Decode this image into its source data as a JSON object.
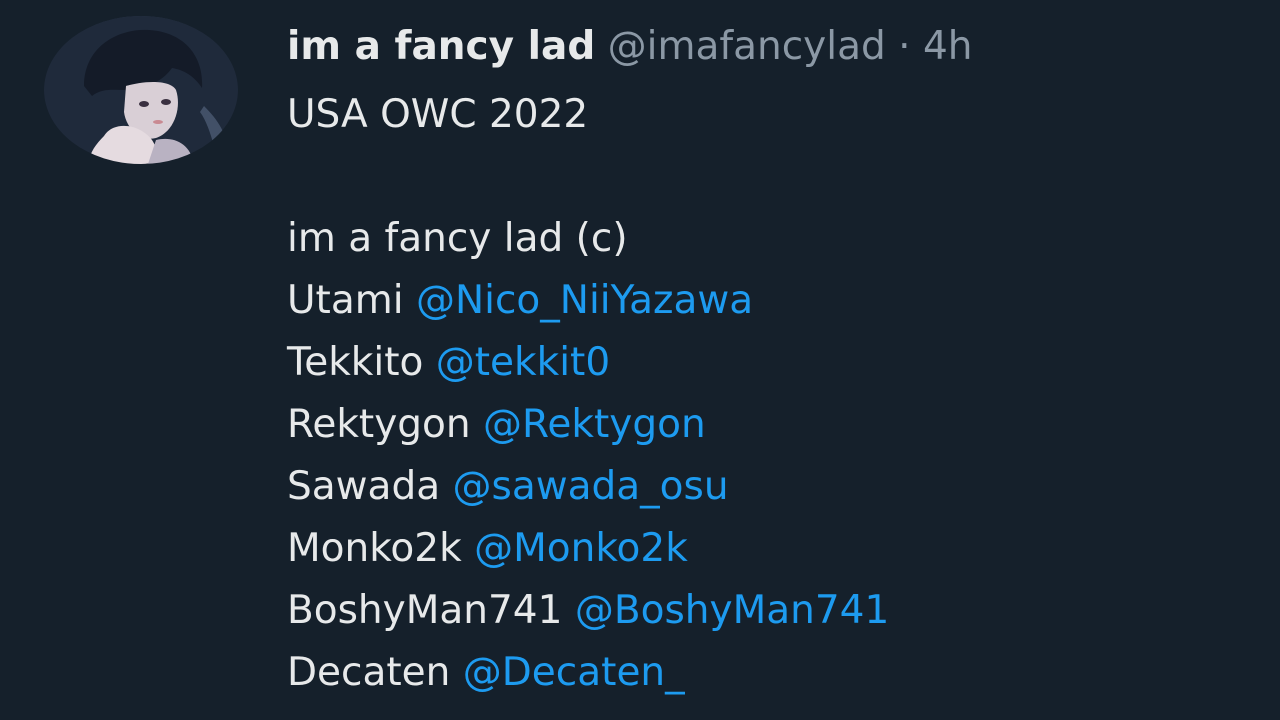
{
  "tweet": {
    "author": {
      "display_name": "im a fancy lad",
      "handle": "@imafancylad",
      "separator": "·",
      "time": "4h",
      "avatar_icon": "profile-avatar"
    },
    "title_line": "USA OWC 2022",
    "captain_line": "im a fancy lad (c)",
    "roster": [
      {
        "name": "Utami",
        "mention": "@Nico_NiiYazawa"
      },
      {
        "name": "Tekkito",
        "mention": "@tekkit0"
      },
      {
        "name": "Rektygon",
        "mention": "@Rektygon"
      },
      {
        "name": "Sawada",
        "mention": "@sawada_osu"
      },
      {
        "name": "Monko2k",
        "mention": "@Monko2k"
      },
      {
        "name": "BoshyMan741",
        "mention": "@BoshyMan741"
      },
      {
        "name": "Decaten",
        "mention": "@Decaten_"
      }
    ]
  },
  "colors": {
    "background": "#15202b",
    "text": "#e7e9ea",
    "muted": "#8b98a5",
    "link": "#1d9bf0"
  }
}
